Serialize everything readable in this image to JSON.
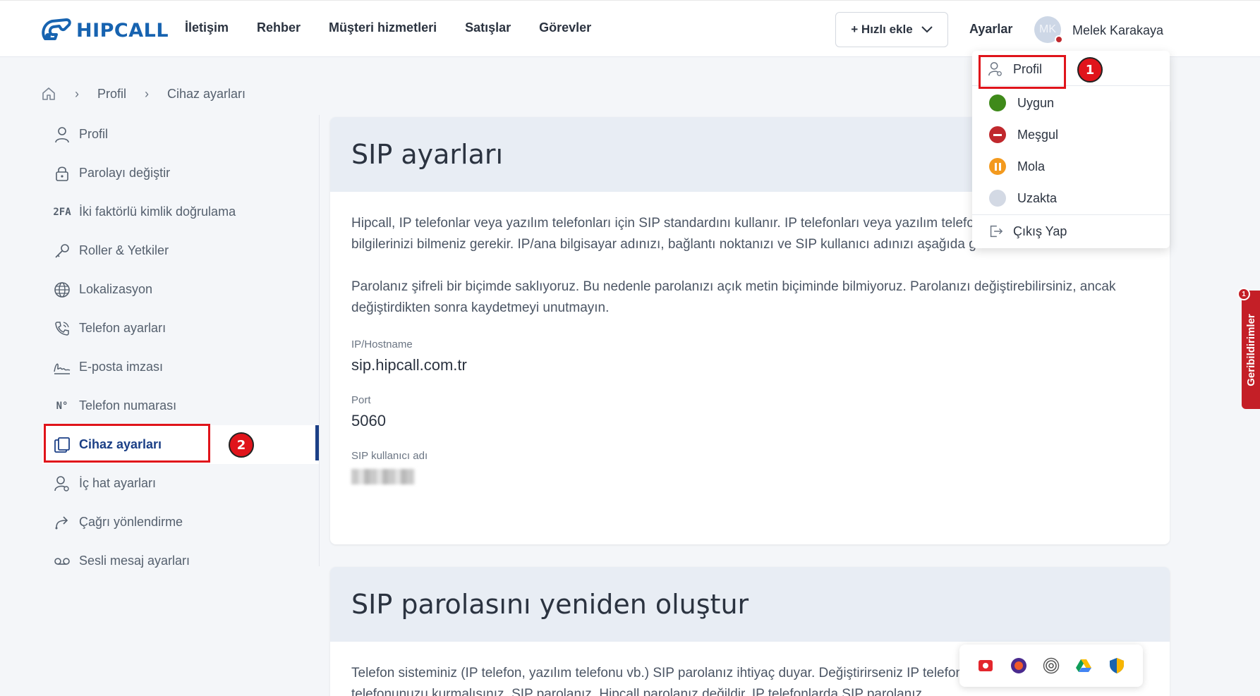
{
  "brand": {
    "name": "HIPCALL",
    "color": "#1763b0"
  },
  "nav": {
    "items": [
      "İletişim",
      "Rehber",
      "Müşteri hizmetleri",
      "Satışlar",
      "Görevler"
    ],
    "quick_add": "+ Hızlı ekle",
    "settings": "Ayarlar",
    "avatar_initials": "MK",
    "user_name": "Melek Karakaya"
  },
  "breadcrumb": [
    "Profil",
    "Cihaz ayarları"
  ],
  "sidebar": {
    "items": [
      {
        "label": "Profil",
        "icon": "user-icon"
      },
      {
        "label": "Parolayı değiştir",
        "icon": "lock-icon"
      },
      {
        "label": "İki faktörlü kimlik doğrulama",
        "icon": "2fa-icon",
        "icon_text": "2FA"
      },
      {
        "label": "Roller & Yetkiler",
        "icon": "key-icon"
      },
      {
        "label": "Lokalizasyon",
        "icon": "globe-icon"
      },
      {
        "label": "Telefon ayarları",
        "icon": "phone-icon"
      },
      {
        "label": "E-posta imzası",
        "icon": "signature-icon"
      },
      {
        "label": "Telefon numarası",
        "icon": "number-icon",
        "icon_text": "N°"
      },
      {
        "label": "Cihaz ayarları",
        "icon": "devices-icon",
        "active": true
      },
      {
        "label": "İç hat ayarları",
        "icon": "user-settings-icon"
      },
      {
        "label": "Çağrı yönlendirme",
        "icon": "forward-icon"
      },
      {
        "label": "Sesli mesaj ayarları",
        "icon": "voicemail-icon"
      }
    ],
    "active_color": "#1b3f86"
  },
  "sip_settings": {
    "title": "SIP ayarları",
    "paragraph1": "Hipcall, IP telefonlar veya yazılım telefonları için SIP standardını kullanır. IP telefonları veya yazılım telefonlarının kurulumu için SIP bilgilerinizi bilmeniz gerekir. IP/ana bilgisayar adınızı, bağlantı noktanızı ve SIP kullanıcı adınızı aşağıda görebilirsiniz.",
    "paragraph2": "Parolanız şifreli bir biçimde saklıyoruz. Bu nedenle parolanızı açık metin biçiminde bilmiyoruz. Parolanızı değiştirebilirsiniz, ancak değiştirdikten sonra kaydetmeyi unutmayın.",
    "fields": [
      {
        "label": "IP/Hostname",
        "value": "sip.hipcall.com.tr"
      },
      {
        "label": "Port",
        "value": "5060"
      },
      {
        "label": "SIP kullanıcı adı",
        "value": ""
      }
    ]
  },
  "sip_password": {
    "title": "SIP parolasını yeniden oluştur",
    "paragraph": "Telefon sisteminiz (IP telefon, yazılım telefonu vb.) SIP parolanız ihtiyaç duyar. Değiştirirseniz IP telefonunuzu veya yazılım telefonunuzu kurmalısınız. SIP parolanız, Hipcall parolanız değildir. IP telefonlarda SIP parolanız"
  },
  "dropdown": {
    "profile": "Profil",
    "statuses": [
      {
        "label": "Uygun",
        "color": "#3f8a1a",
        "icon": "available-icon"
      },
      {
        "label": "Meşgul",
        "color": "#c0282d",
        "icon": "busy-icon"
      },
      {
        "label": "Mola",
        "color": "#f39a1e",
        "icon": "pause-icon"
      },
      {
        "label": "Uzakta",
        "color": "#d3d9e4",
        "icon": "away-icon"
      }
    ],
    "logout": "Çıkış Yap"
  },
  "annotations": {
    "one": "1",
    "two": "2",
    "color": "#e0141b"
  },
  "feedback": {
    "label": "Geribildirimler",
    "badge": "1"
  }
}
